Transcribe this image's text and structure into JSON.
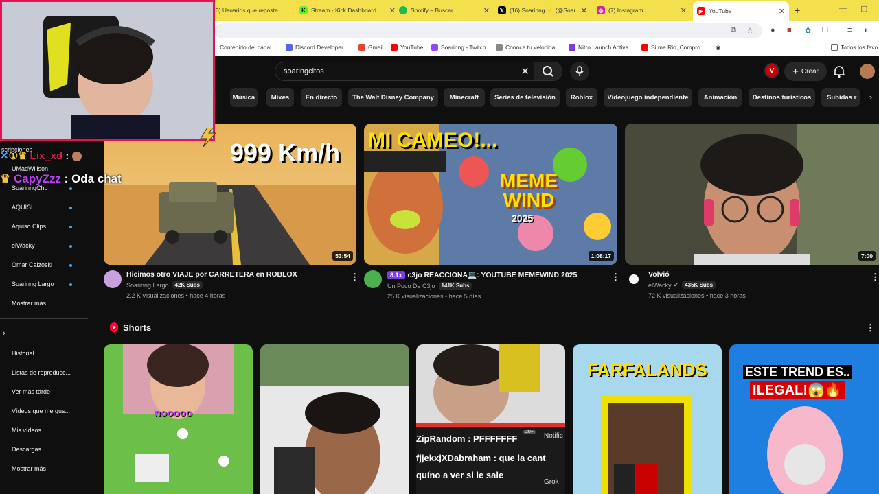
{
  "browser": {
    "tabs": [
      {
        "label": "3) Usuarios que reposte",
        "icon": "x-icon",
        "color": "#000000"
      },
      {
        "label": "Stream - Kick Dashboard",
        "icon": "kick-icon",
        "color": "#53fc18"
      },
      {
        "label": "Spotify – Buscar",
        "icon": "spotify-icon",
        "color": "#1db954"
      },
      {
        "label": "(16) Soarinng ⚡ (@Soar",
        "icon": "x-icon",
        "color": "#000000"
      },
      {
        "label": "(7) Instagram",
        "icon": "instagram-icon",
        "color": "#d6249f"
      },
      {
        "label": "YouTube",
        "icon": "youtube-icon",
        "color": "#ff0000"
      }
    ],
    "new_tab_label": "+",
    "bookmarks": [
      {
        "label": "Contenido del canal...",
        "color": "#ff0000"
      },
      {
        "label": "Discord Developer...",
        "color": "#5865f2"
      },
      {
        "label": "Gmail",
        "color": "#ea4335"
      },
      {
        "label": "YouTube",
        "color": "#ff0000"
      },
      {
        "label": "Soarinng - Twitch",
        "color": "#9146ff"
      },
      {
        "label": "Conoce tu velocida...",
        "color": "#888888"
      },
      {
        "label": "Nitro Launch Activa...",
        "color": "#7c3aed"
      },
      {
        "label": "Si me Rio, Compro...",
        "color": "#ff0000"
      }
    ],
    "all_bookmarks_label": "Todos los favo"
  },
  "header": {
    "search_query": "soaringcitos",
    "create_label": "Crear",
    "profile_badge": "V"
  },
  "chips": [
    "Música",
    "Mixes",
    "En directo",
    "The Walt Disney Company",
    "Minecraft",
    "Series de televisión",
    "Roblox",
    "Videojuego independiente",
    "Animación",
    "Destinos turísticos",
    "Subidas r"
  ],
  "sidebar": {
    "section_label": "scripciones",
    "subscriptions": [
      "UMadWillson",
      "SoarinngChu",
      "AQUISI",
      "Aquiso Clips",
      "elWacky",
      "Omar Calzoski",
      "Soarinng Largo"
    ],
    "show_more": "Mostrar más",
    "you_items": [
      "Historial",
      "Listas de reproducc...",
      "Ver más tarde",
      "Vídeos que me gus...",
      "Mis vídeos",
      "Descargas"
    ],
    "show_more_2": "Mostrar más"
  },
  "videos": [
    {
      "overlay_text": "999 Km/h",
      "title": "Hicimos otro VIAJE por CARRETERA en ROBLOX",
      "channel": "Soarinng Largo",
      "subs": "42K Subs",
      "stats": "2,2 K visualizaciones • hace 4 horas",
      "duration": "53:54"
    },
    {
      "overlay_text": "MI CAMEO!...",
      "overlay_text_2": "MEME WIND",
      "overlay_text_3": "2025",
      "badge": "8.1x",
      "title": "c3jo REACCIONA💻: YOUTUBE MEMEWIND 2025",
      "channel": "Un Poco De C3jo",
      "subs": "141K Subs",
      "stats": "25 K visualizaciones • hace 5 días",
      "duration": "1:08:17"
    },
    {
      "title": "Volvió",
      "channel": "elWacky",
      "subs": "435K Subs",
      "stats": "72 K visualizaciones • hace 3 horas",
      "duration": "7:00"
    }
  ],
  "shorts": {
    "heading": "Shorts",
    "items": [
      {
        "overlay": "nooooo"
      },
      {
        "overlay": ""
      },
      {
        "overlay_lines": [
          "ZipRandom : PFFFFFFF",
          "fjjekxjXDabraham : que la cant",
          "quíno a ver si le sale"
        ],
        "side_labels": [
          "Notific",
          "Grok"
        ],
        "counter": "20+"
      },
      {
        "overlay": "FARFALANDS"
      },
      {
        "overlay": "ESTE TREND ES..",
        "overlay_2": "ILEGAL!😱🔥"
      }
    ]
  },
  "chat_overlay": [
    {
      "user": "Lix_xd",
      "message": "",
      "user_color": "#e0174f"
    },
    {
      "user": "CapyZzz",
      "message": "Oda chat",
      "user_color": "#c23cff"
    }
  ]
}
